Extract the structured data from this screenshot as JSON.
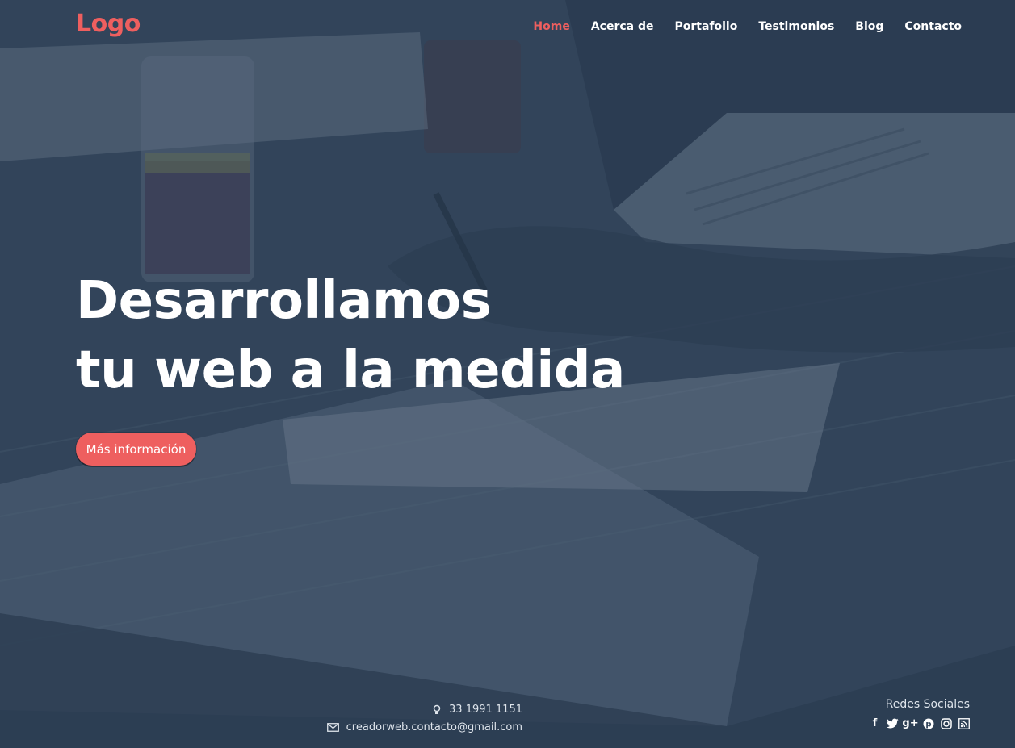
{
  "header": {
    "logo": "Logo",
    "nav": [
      {
        "label": "Home",
        "active": true
      },
      {
        "label": "Acerca de",
        "active": false
      },
      {
        "label": "Portafolio",
        "active": false
      },
      {
        "label": "Testimonios",
        "active": false
      },
      {
        "label": "Blog",
        "active": false
      },
      {
        "label": "Contacto",
        "active": false
      }
    ]
  },
  "hero": {
    "headline_line1": "Desarrollamos",
    "headline_line2": "tu web a la medida",
    "cta_label": "Más información"
  },
  "footer": {
    "phone": "33 1991 1151",
    "email": "creadorweb.contacto@gmail.com",
    "social_title": "Redes Sociales",
    "social_icons": [
      "facebook-icon",
      "twitter-icon",
      "google-plus-icon",
      "pinterest-icon",
      "instagram-icon",
      "rss-icon"
    ]
  },
  "colors": {
    "accent": "#ee5f5f",
    "overlay": "#2c3e54",
    "text": "#ffffff"
  }
}
